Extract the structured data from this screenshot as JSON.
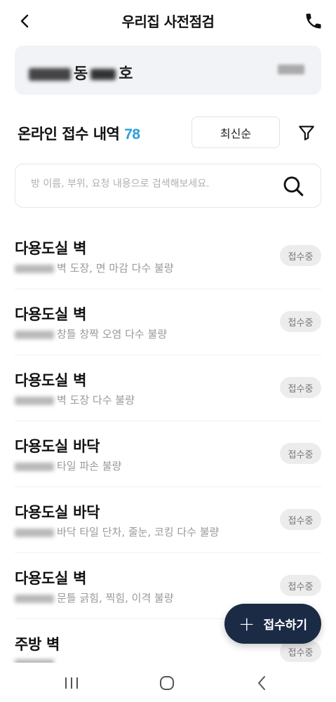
{
  "header": {
    "title": "우리집 사전점검",
    "back_icon": "chevron-left-icon",
    "call_icon": "phone-icon"
  },
  "unit": {
    "name_part1": "동",
    "name_part2": "호"
  },
  "list_header": {
    "label": "온라인 접수 내역",
    "count": "78",
    "count_color": "#2a9fd6",
    "sort_label": "최신순",
    "filter_icon": "filter-icon"
  },
  "search": {
    "placeholder": "방 이름, 부위, 요청 내용으로 검색해보세요.",
    "value": "",
    "icon": "search-icon"
  },
  "items": [
    {
      "title": "다용도실 벽",
      "desc": "벽 도장, 면 마감 다수 불량",
      "status": "접수중"
    },
    {
      "title": "다용도실 벽",
      "desc": "창틀 창짝 오염 다수 불량",
      "status": "접수중"
    },
    {
      "title": "다용도실 벽",
      "desc": "벽 도장 다수 불량",
      "status": "접수중"
    },
    {
      "title": "다용도실 바닥",
      "desc": "타일 파손 불량",
      "status": "접수중"
    },
    {
      "title": "다용도실 바닥",
      "desc": "바닥 타일 단차, 줄눈, 코킹 다수 불량",
      "status": "접수중"
    },
    {
      "title": "다용도실 벽",
      "desc": "문틀 긁힘, 찍힘, 이격 불량",
      "status": "접수중"
    },
    {
      "title": "주방 벽",
      "desc": "",
      "status": "접수중"
    }
  ],
  "fab": {
    "label": "접수하기",
    "icon": "plus-icon",
    "color": "#1b2b45"
  },
  "navbar": {
    "recent_icon": "recent-apps-icon",
    "home_icon": "home-icon",
    "back_icon": "back-icon"
  }
}
